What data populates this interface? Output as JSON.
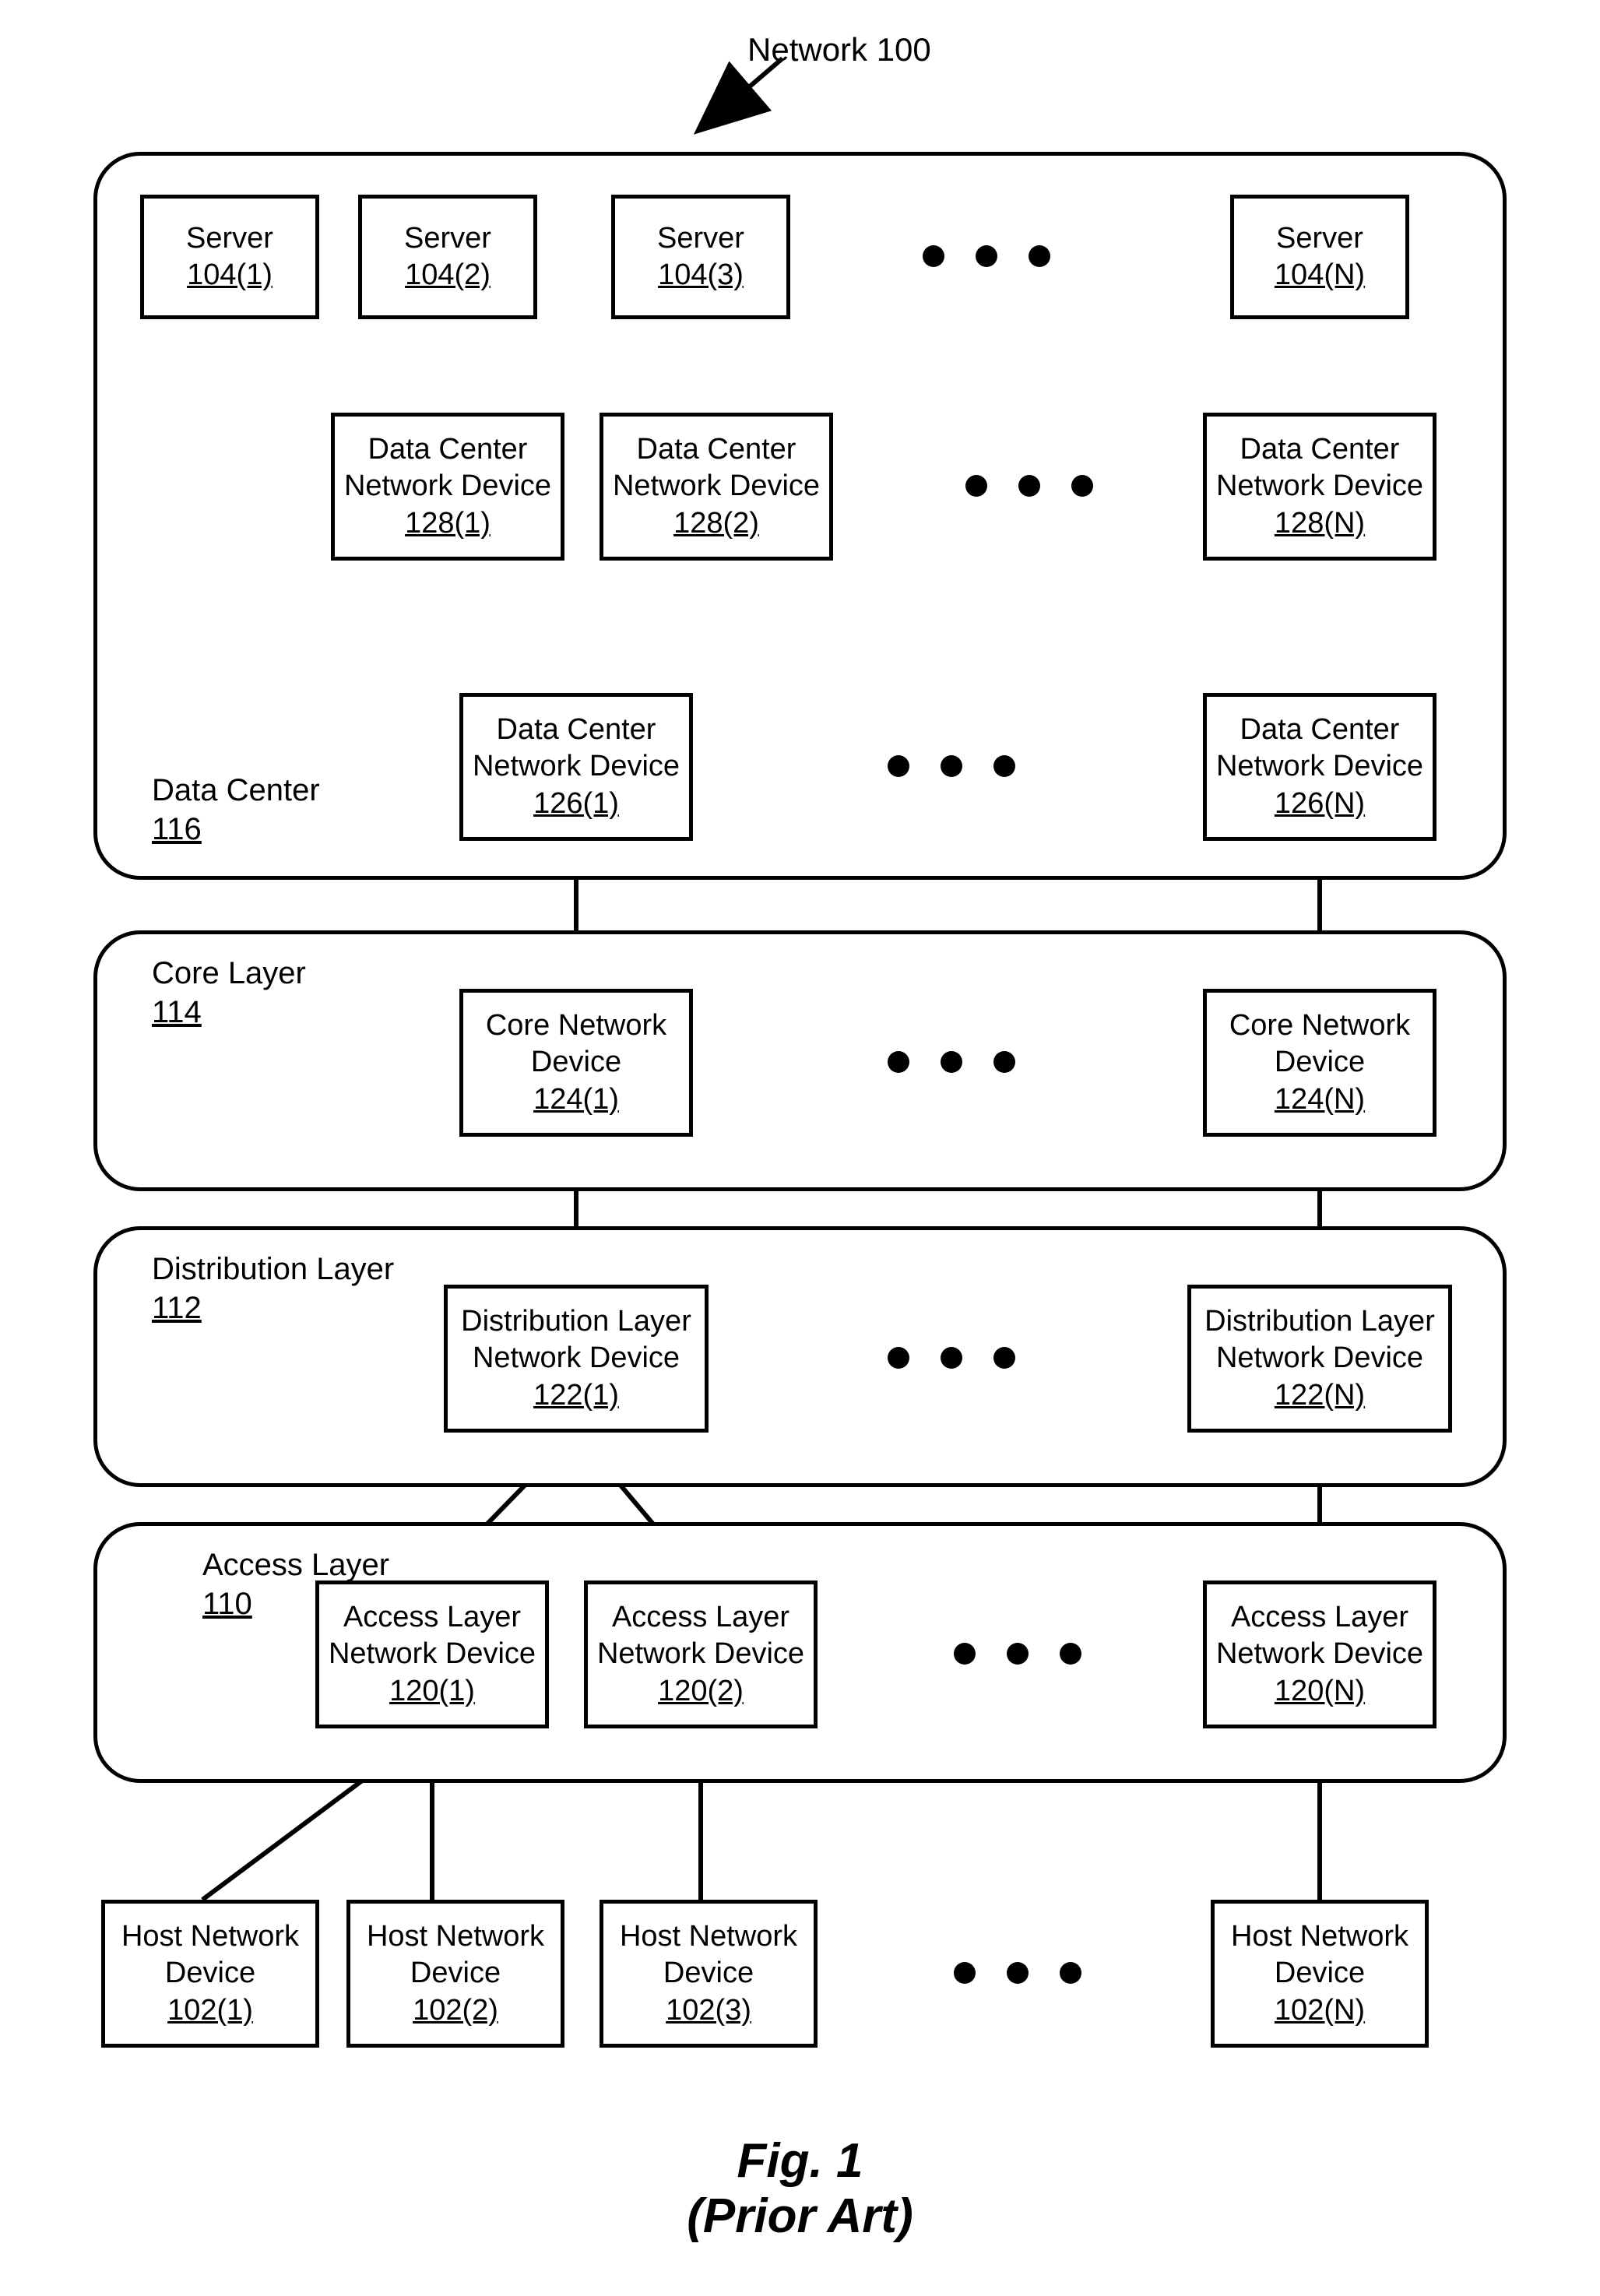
{
  "title": "Network 100",
  "caption_line1": "Fig. 1",
  "caption_line2": "(Prior Art)",
  "layers": {
    "datacenter": {
      "name": "Data Center",
      "id": "116"
    },
    "core": {
      "name": "Core Layer",
      "id": "114"
    },
    "dist": {
      "name": "Distribution Layer",
      "id": "112"
    },
    "access": {
      "name": "Access Layer",
      "id": "110"
    }
  },
  "servers": {
    "name": "Server",
    "ids": {
      "s1": "104(1)",
      "s2": "104(2)",
      "s3": "104(3)",
      "sn": "104(N)"
    }
  },
  "dc_top": {
    "name_l1": "Data Center",
    "name_l2": "Network Device",
    "ids": {
      "d1": "128(1)",
      "d2": "128(2)",
      "dn": "128(N)"
    }
  },
  "dc_bot": {
    "name_l1": "Data Center",
    "name_l2": "Network Device",
    "ids": {
      "d1": "126(1)",
      "dn": "126(N)"
    }
  },
  "core_dev": {
    "name_l1": "Core Network",
    "name_l2": "Device",
    "ids": {
      "d1": "124(1)",
      "dn": "124(N)"
    }
  },
  "dist_dev": {
    "name_l1": "Distribution Layer",
    "name_l2": "Network Device",
    "ids": {
      "d1": "122(1)",
      "dn": "122(N)"
    }
  },
  "access_dev": {
    "name_l1": "Access Layer",
    "name_l2": "Network Device",
    "ids": {
      "d1": "120(1)",
      "d2": "120(2)",
      "dn": "120(N)"
    }
  },
  "host_dev": {
    "name_l1": "Host Network",
    "name_l2": "Device",
    "ids": {
      "d1": "102(1)",
      "d2": "102(2)",
      "d3": "102(3)",
      "dn": "102(N)"
    }
  }
}
